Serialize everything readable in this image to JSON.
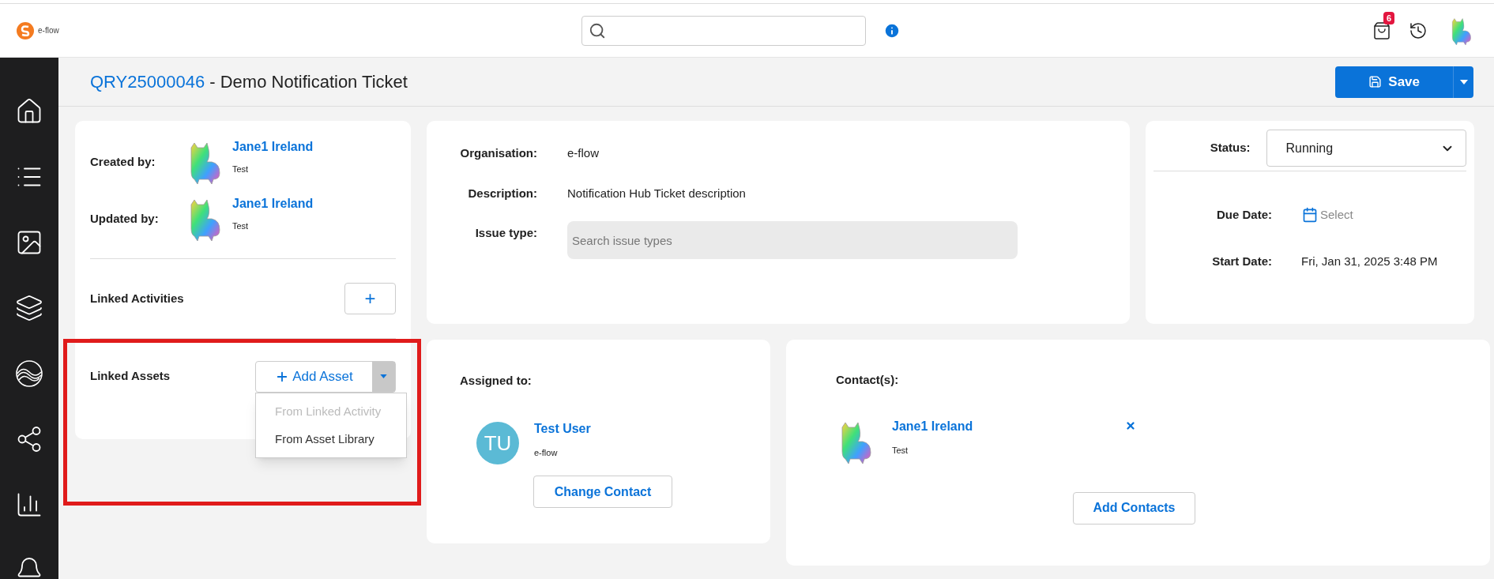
{
  "top_bar": {
    "logo_text": "e-flow",
    "cart_badge": "6"
  },
  "sidebar": {
    "items": [
      {
        "kind": "home"
      },
      {
        "kind": "list"
      },
      {
        "kind": "image"
      },
      {
        "kind": "layers"
      },
      {
        "kind": "waves"
      },
      {
        "kind": "network"
      },
      {
        "kind": "chart"
      },
      {
        "kind": "bell"
      }
    ]
  },
  "header": {
    "ticket_id": "QRY25000046",
    "title": " - Demo Notification Ticket",
    "save_label": "Save"
  },
  "people": [
    {
      "label": "Created by:",
      "name": "Jane1 Ireland",
      "sub": "Test"
    },
    {
      "label": "Updated by:",
      "name": "Jane1 Ireland",
      "sub": "Test"
    }
  ],
  "linked_activities": {
    "label": "Linked Activities",
    "button": "+"
  },
  "linked_assets": {
    "label": "Linked Assets",
    "button": "Add Asset",
    "menu_open": true,
    "menu": [
      {
        "label": "From Linked Activity",
        "disabled": true
      },
      {
        "label": "From Asset Library",
        "disabled": false
      }
    ]
  },
  "details": [
    {
      "kind": "text",
      "label": "Organisation:",
      "value": "e-flow"
    },
    {
      "kind": "text",
      "label": "Description:",
      "value": "Notification Hub Ticket description"
    },
    {
      "kind": "field",
      "label": "Issue type:",
      "placeholder": "Search issue types"
    }
  ],
  "status": {
    "label": "Status:",
    "value": "Running"
  },
  "dates": [
    {
      "kind": "picker",
      "label": "Due Date:",
      "placeholder": "Select"
    },
    {
      "kind": "text",
      "label": "Start Date:",
      "value": "Fri, Jan 31, 2025 3:48 PM"
    }
  ],
  "assigned": {
    "label": "Assigned to:",
    "initials": "TU",
    "name": "Test User",
    "sub": "e-flow",
    "button": "Change Contact"
  },
  "contacts": {
    "label": "Contact(s):",
    "items": [
      {
        "name": "Jane1 Ireland",
        "sub": "Test"
      }
    ],
    "button": "Add Contacts"
  }
}
